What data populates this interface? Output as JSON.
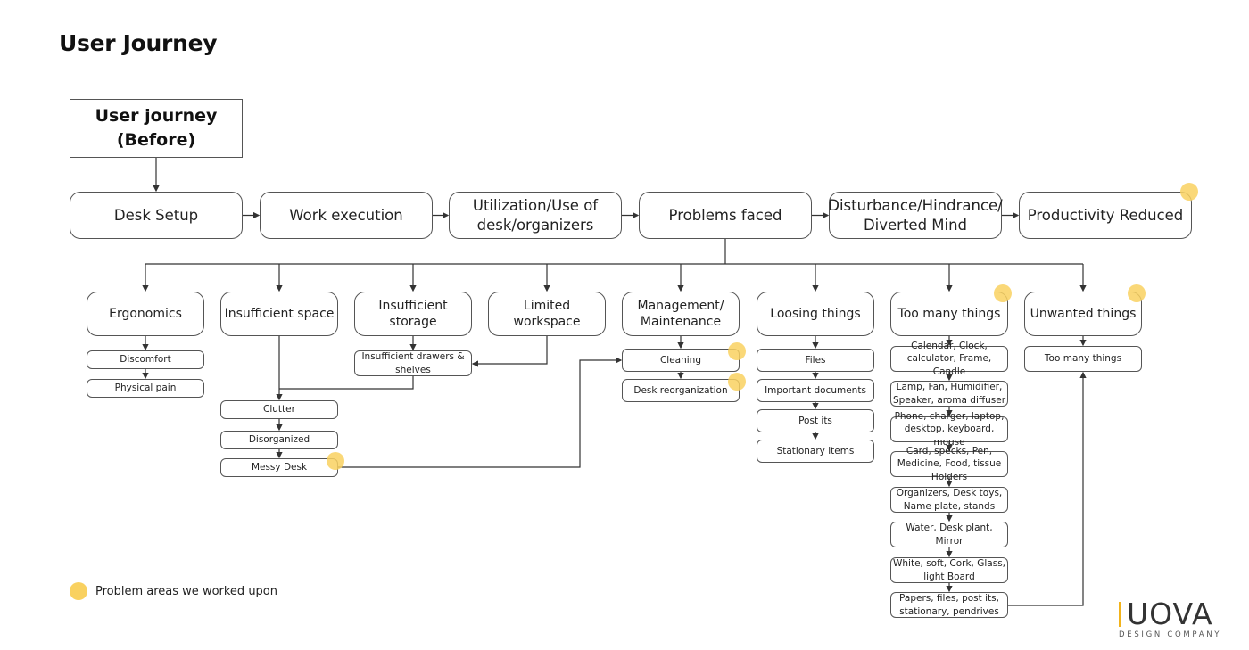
{
  "page": {
    "title": "User Journey"
  },
  "start": {
    "label": "User journey\n(Before)"
  },
  "main_flow": [
    {
      "id": "desk-setup",
      "label": "Desk Setup",
      "highlight": false
    },
    {
      "id": "work-execution",
      "label": "Work execution",
      "highlight": false
    },
    {
      "id": "utilization",
      "label": "Utilization/Use of desk/organizers",
      "highlight": false
    },
    {
      "id": "problems-faced",
      "label": "Problems faced",
      "highlight": false
    },
    {
      "id": "disturbance",
      "label": "Disturbance/Hindrance/ Diverted Mind",
      "highlight": false
    },
    {
      "id": "productivity-reduced",
      "label": "Productivity Reduced",
      "highlight": true
    }
  ],
  "problems": [
    {
      "id": "ergonomics",
      "label": "Ergonomics",
      "highlight": false,
      "children": [
        {
          "label": "Discomfort",
          "highlight": false
        },
        {
          "label": "Physical pain",
          "highlight": false
        }
      ]
    },
    {
      "id": "insufficient-space",
      "label": "Insufficient space",
      "highlight": false,
      "children": [
        {
          "label": "Clutter",
          "highlight": false
        },
        {
          "label": "Disorganized",
          "highlight": false
        },
        {
          "label": "Messy Desk",
          "highlight": true
        }
      ]
    },
    {
      "id": "insufficient-storage",
      "label": "Insufficient storage",
      "highlight": false,
      "children": [
        {
          "label": "Insufficient drawers & shelves",
          "highlight": false
        }
      ]
    },
    {
      "id": "limited-workspace",
      "label": "Limited workspace",
      "highlight": false,
      "children": []
    },
    {
      "id": "management",
      "label": "Management/ Maintenance",
      "highlight": false,
      "children": [
        {
          "label": "Cleaning",
          "highlight": true
        },
        {
          "label": "Desk reorganization",
          "highlight": true
        }
      ]
    },
    {
      "id": "loosing-things",
      "label": "Loosing things",
      "highlight": false,
      "children": [
        {
          "label": "Files",
          "highlight": false
        },
        {
          "label": "Important documents",
          "highlight": false
        },
        {
          "label": "Post its",
          "highlight": false
        },
        {
          "label": "Stationary items",
          "highlight": false
        }
      ]
    },
    {
      "id": "too-many-things",
      "label": "Too many things",
      "highlight": true,
      "children": [
        {
          "label": "Calendar, Clock, calculator, Frame,  Candle",
          "highlight": false
        },
        {
          "label": "Lamp, Fan, Humidifier, Speaker, aroma diffuser",
          "highlight": false
        },
        {
          "label": "Phone, charger, laptop, desktop, keyboard, mouse",
          "highlight": false
        },
        {
          "label": "Card, specks, Pen, Medicine, Food, tissue Holders",
          "highlight": false
        },
        {
          "label": "Organizers, Desk toys, Name plate, stands",
          "highlight": false
        },
        {
          "label": "Water, Desk plant, Mirror",
          "highlight": false
        },
        {
          "label": "White, soft, Cork, Glass, light Board",
          "highlight": false
        },
        {
          "label": "Papers, files, post its, stationary, pendrives",
          "highlight": false
        }
      ]
    },
    {
      "id": "unwanted-things",
      "label": "Unwanted things",
      "highlight": true,
      "children": [
        {
          "label": "Too many things",
          "highlight": false
        }
      ]
    }
  ],
  "legend": {
    "label": "Problem areas we worked upon",
    "color": "#f9d160"
  },
  "logo": {
    "name": "UOVA",
    "subtitle": "DESIGN COMPANY",
    "accent": "#f2b31b"
  }
}
